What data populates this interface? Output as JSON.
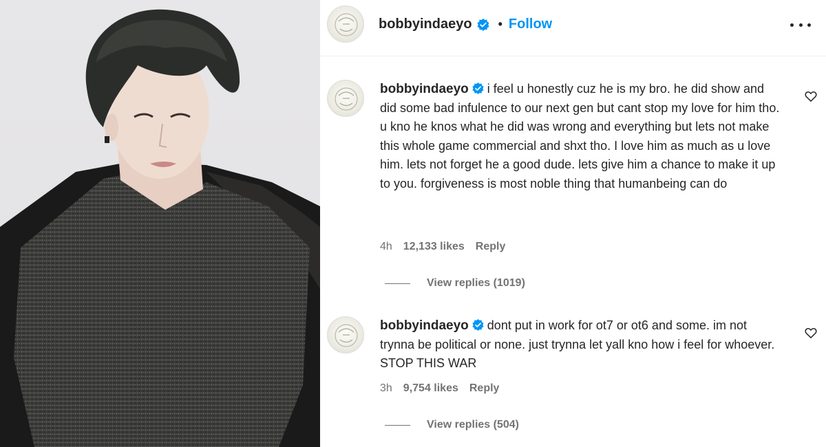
{
  "post": {
    "username": "bobbyindaeyo",
    "separator": "•",
    "follow_label": "Follow",
    "icons": {
      "verified": "verified-badge-icon",
      "more": "more-options-icon",
      "like": "heart-icon"
    },
    "colors": {
      "follow": "#0095f6",
      "verified": "#0095f6",
      "meta": "#737373"
    }
  },
  "comments": [
    {
      "username": "bobbyindaeyo",
      "text": "i feel u honestly cuz he is my bro. he did show and did some bad infulence to our next gen but cant stop my love for him tho. u kno he knos what he did was wrong and everything but lets not make this whole game commercial and shxt tho. I love him as much as u love him. lets not forget he a good dude. lets give him a chance to make it up to you. forgiveness is most noble thing that humanbeing can do",
      "time": "4h",
      "likes": "12,133 likes",
      "reply_label": "Reply",
      "view_replies": "View replies (1019)"
    },
    {
      "username": "bobbyindaeyo",
      "text": "dont put in work for ot7 or ot6 and some. im not trynna be political or none. just trynna let yall kno how i feel for whoever. STOP THIS WAR",
      "time": "3h",
      "likes": "9,754 likes",
      "reply_label": "Reply",
      "view_replies": "View replies (504)"
    }
  ]
}
